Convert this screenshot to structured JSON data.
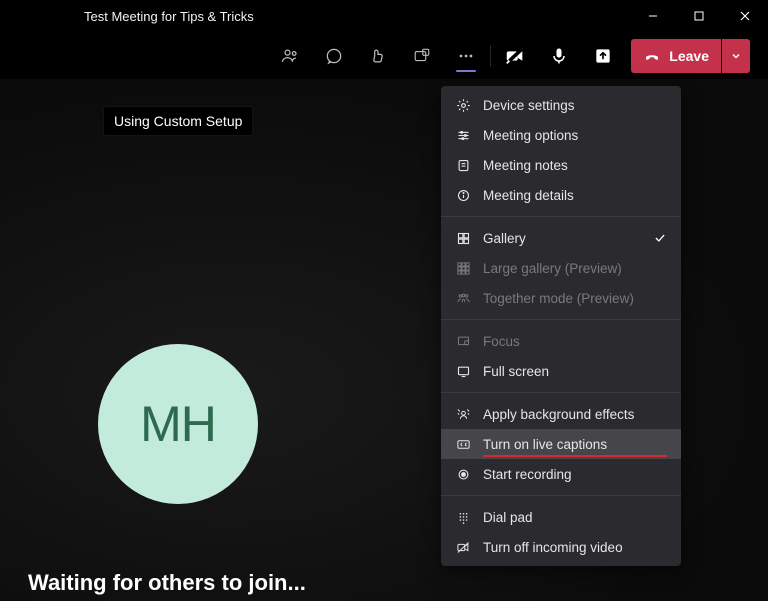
{
  "window": {
    "title": "Test Meeting for Tips & Tricks"
  },
  "toolbar": {
    "leave_label": "Leave"
  },
  "tip": {
    "text": "Using Custom Setup"
  },
  "avatar": {
    "initials": "MH"
  },
  "status": {
    "waiting": "Waiting for others to join..."
  },
  "menu": {
    "device_settings": "Device settings",
    "meeting_options": "Meeting options",
    "meeting_notes": "Meeting notes",
    "meeting_details": "Meeting details",
    "gallery": "Gallery",
    "large_gallery": "Large gallery (Preview)",
    "together_mode": "Together mode (Preview)",
    "focus": "Focus",
    "full_screen": "Full screen",
    "background_effects": "Apply background effects",
    "live_captions": "Turn on live captions",
    "start_recording": "Start recording",
    "dial_pad": "Dial pad",
    "incoming_video": "Turn off incoming video"
  }
}
